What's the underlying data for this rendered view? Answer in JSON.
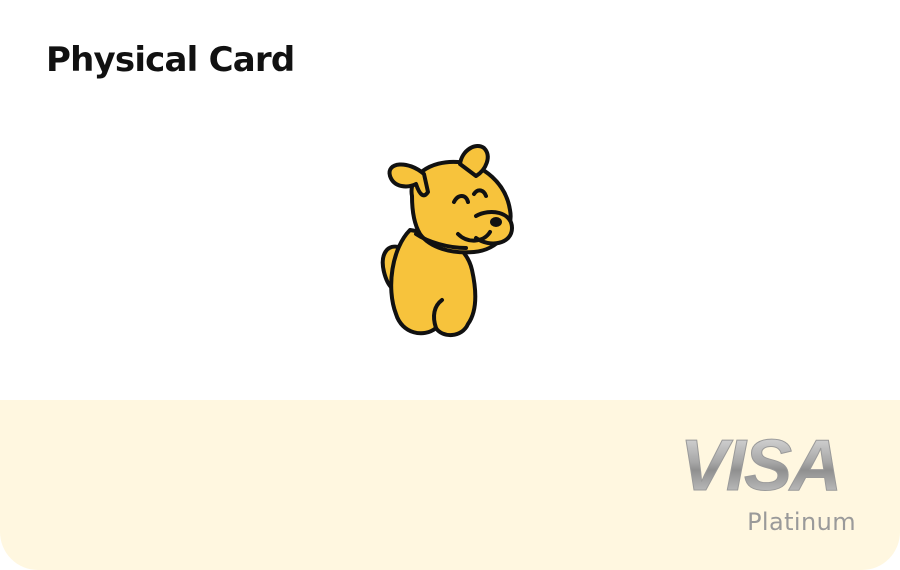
{
  "card": {
    "title": "Physical Card",
    "mascot_icon": "yellow-dog-mascot",
    "network": {
      "brand": "VISA",
      "tier": "Platinum"
    }
  },
  "colors": {
    "background": "#ffffff",
    "band": "#fff7e0",
    "mascot_yellow": "#f7c33c",
    "outline": "#111111",
    "visa_silver": "#a8a8a8",
    "tier_text": "#9a9a9a"
  }
}
